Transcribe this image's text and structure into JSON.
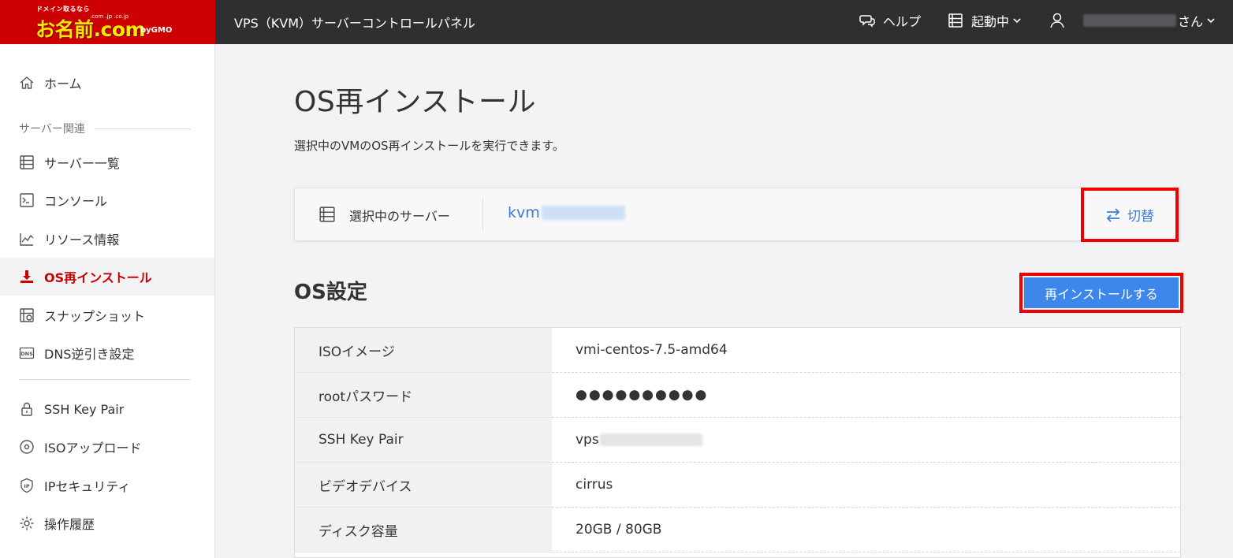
{
  "header": {
    "logo_tagline": "ドメイン取るなら",
    "logo_tlds": ".com .jp .co.jp",
    "logo_text": "お名前.com",
    "logo_gmo": "byGMO",
    "title": "VPS（KVM）サーバーコントロールパネル",
    "help_label": "ヘルプ",
    "status_label": "起動中",
    "user_suffix": "さん"
  },
  "sidebar": {
    "home": "ホーム",
    "section_label": "サーバー関連",
    "items": [
      {
        "label": "サーバー一覧"
      },
      {
        "label": "コンソール"
      },
      {
        "label": "リソース情報"
      },
      {
        "label": "OS再インストール"
      },
      {
        "label": "スナップショット"
      },
      {
        "label": "DNS逆引き設定"
      }
    ],
    "items2": [
      {
        "label": "SSH Key Pair"
      },
      {
        "label": "ISOアップロード"
      },
      {
        "label": "IPセキュリティ"
      },
      {
        "label": "操作履歴"
      }
    ],
    "dns_icon_text": "DNS",
    "ip_icon_text": "IP"
  },
  "main": {
    "title": "OS再インストール",
    "description": "選択中のVMのOS再インストールを実行できます。",
    "server_label": "選択中のサーバー",
    "server_name_prefix": "kvm",
    "switch_label": "切替",
    "os_section_title": "OS設定",
    "reinstall_button": "再インストールする",
    "settings": [
      {
        "key": "ISOイメージ",
        "value": "vmi-centos-7.5-amd64"
      },
      {
        "key": "rootパスワード",
        "value": "●●●●●●●●●●"
      },
      {
        "key": "SSH Key Pair",
        "value": "vps"
      },
      {
        "key": "ビデオデバイス",
        "value": "cirrus"
      },
      {
        "key": "ディスク容量",
        "value": "20GB / 80GB"
      }
    ]
  },
  "colors": {
    "header_bg": "#2e2f31",
    "logo_bg": "#cc0000",
    "accent_red": "#cc0000",
    "link_blue": "#3a7bd5",
    "button_blue": "#3d86ea",
    "highlight_border": "#ee0000"
  }
}
